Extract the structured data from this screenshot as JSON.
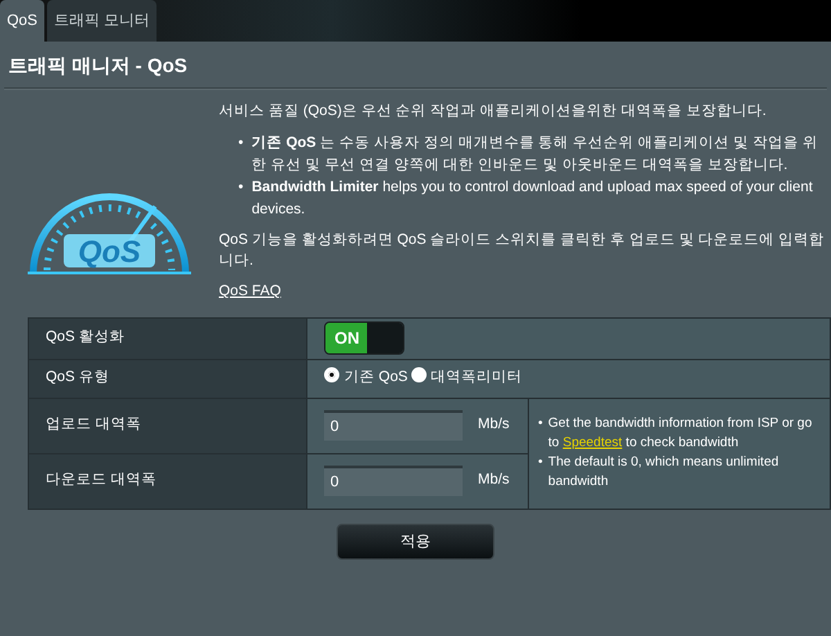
{
  "tabs": [
    {
      "label": "QoS",
      "selected": true
    },
    {
      "label": "트래픽 모니터",
      "selected": false
    }
  ],
  "title": "트래픽 매니저 - QoS",
  "intro": "서비스 품질 (QoS)은 우선 순위 작업과 애플리케이션을위한 대역폭을 보장합니다.",
  "logo_text": "QoS",
  "bullets": [
    {
      "marker": "•",
      "text": "**기존 QoS** 는 수동 사용자 정의 매개변수를 통해 우선순위 애플리케이션 및 작업을 위한 유선 및 무선 연결 양쪽에 대한 인바운드 및 아웃바운드 대역폭을 보장합니다."
    },
    {
      "marker": "•",
      "text": "**Bandwidth Limiter** helps you to control download and upload max speed of your client devices."
    }
  ],
  "instruction": "QoS 기능을 활성화하려면 QoS 슬라이드 스위치를 클릭한 후 업로드 및 다운로드에 입력합니다.",
  "faq_link": "QoS FAQ",
  "settings": [
    {
      "kind": "toggle",
      "label": "QoS 활성화",
      "on": true,
      "text": "ON"
    },
    {
      "kind": "radio",
      "label": "QoS 유형",
      "options": [
        {
          "label": "기존 QoS",
          "selected": true
        },
        {
          "label": "대역폭리미터",
          "selected": false
        }
      ]
    },
    {
      "kind": "input",
      "label": "업로드 대역폭",
      "value": "0",
      "unit": "Mb/s"
    },
    {
      "kind": "input",
      "label": "다운로드 대역폭",
      "value": "0",
      "unit": "Mb/s"
    }
  ],
  "help": [
    {
      "marker": "•",
      "before": "Get the bandwidth information from ISP or go to",
      "link": "Speedtest",
      "after": "to check bandwidth"
    },
    {
      "marker": "•",
      "before": "The default is 0, which means unlimited bandwidth"
    }
  ],
  "apply_button": "적용"
}
